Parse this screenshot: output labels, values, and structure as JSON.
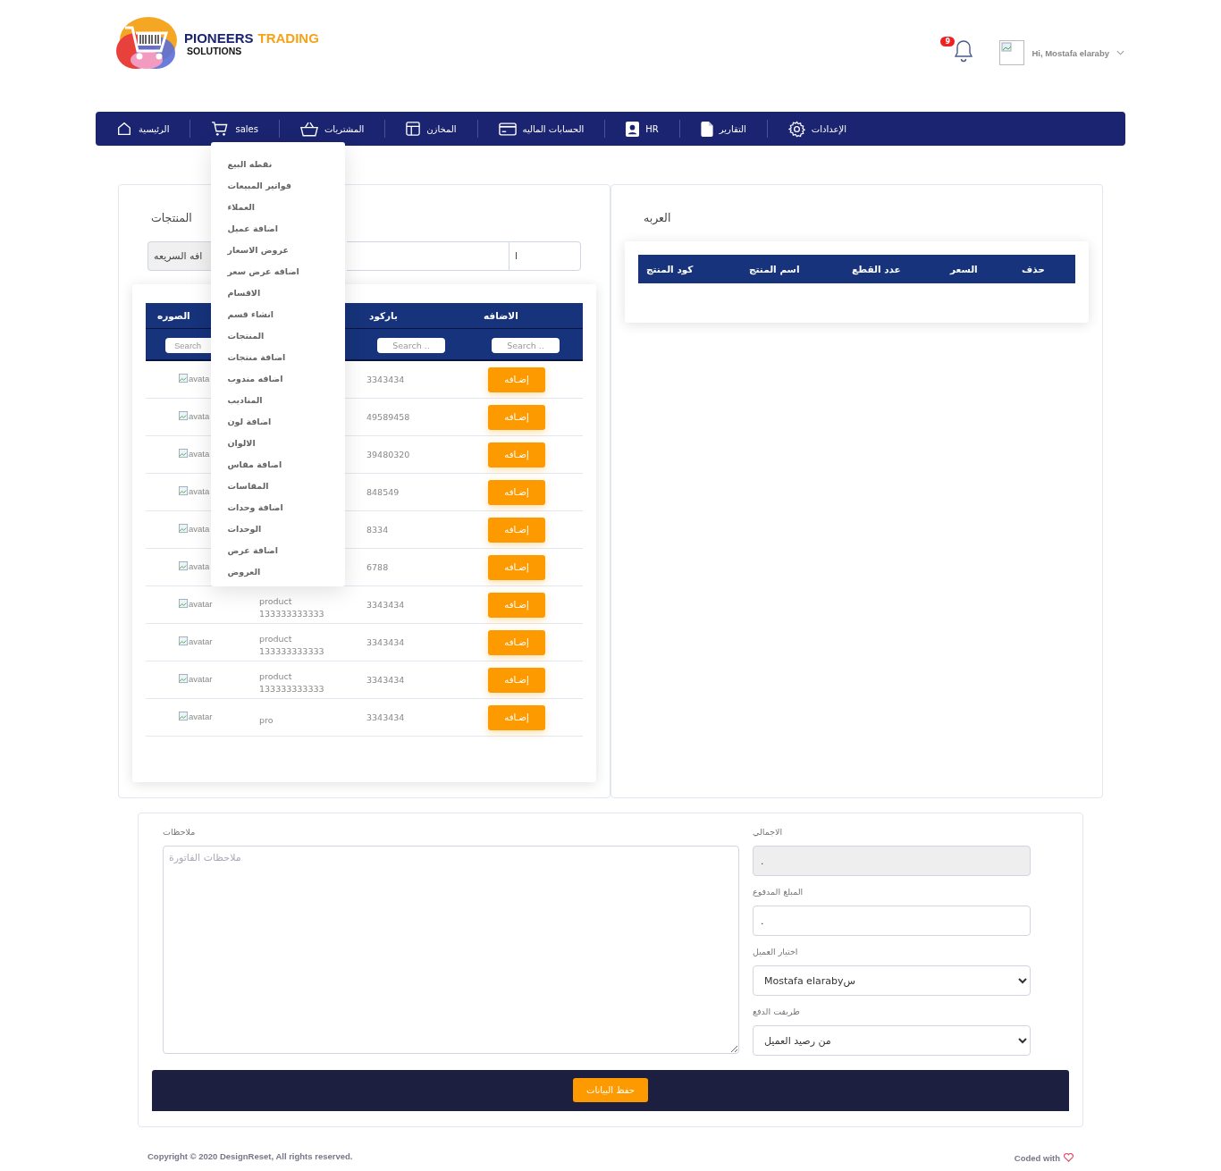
{
  "header": {
    "logo": {
      "word_1": "PIONEERS",
      "word_2": "TRADING",
      "word_3": "SOLUTIONS"
    },
    "notifications": {
      "count": "9"
    },
    "user": {
      "greeting": "Hi, Mostafa elaraby"
    }
  },
  "nav": [
    {
      "label": "الإعدادات",
      "kind": "gear"
    },
    {
      "label": "التقارير",
      "kind": "file"
    },
    {
      "label": "HR",
      "kind": "badge"
    },
    {
      "label": "الحسابات الماليه",
      "kind": "card"
    },
    {
      "label": "المخازن",
      "kind": "layout"
    },
    {
      "label": "المشتريات",
      "kind": "basket"
    },
    {
      "label": "sales",
      "kind": "cart",
      "menu": [
        "نقطه البيع",
        "فواتير المبيعات",
        "العملاء",
        "اضافة عميل",
        "عروض الاسعار",
        "اضافه عرض سعر",
        "الاقسام",
        "انشاء قسم",
        "المنتجات",
        "اضافة منتجات",
        "اضافه مندوب",
        "المناديب",
        "اضافة لون",
        "الالوان",
        "اضافة مقاس",
        "المقاسات",
        "اضافة وحدات",
        "الوحدات",
        "اضافة عرض",
        "العروض"
      ]
    },
    {
      "label": "الرئيسية",
      "kind": "home"
    }
  ],
  "products": {
    "title": "المنتجات",
    "quick_add": "افه السريعه",
    "input_addon": "ا",
    "columns": [
      {
        "label": "الاضافه",
        "placeholder": "Search .."
      },
      {
        "label": "باركود",
        "placeholder": "Search .."
      },
      {},
      {
        "label": "الصوره",
        "placeholder": "Search"
      }
    ],
    "rows": [
      {
        "image": "avata",
        "barcode": "3343434",
        "action": "إضـافه"
      },
      {
        "image": "avata",
        "barcode": "49589458",
        "action": "إضـافه"
      },
      {
        "image": "avata",
        "barcode": "39480320",
        "action": "إضـافه"
      },
      {
        "image": "avata",
        "barcode": "848549",
        "action": "إضـافه"
      },
      {
        "image": "avata",
        "barcode": "8334",
        "action": "إضـافه"
      },
      {
        "image": "avata",
        "barcode": "6788",
        "action": "إضـافه"
      },
      {
        "image": "avatar",
        "name": "product 133333333333",
        "barcode": "3343434",
        "action": "إضـافه"
      },
      {
        "image": "avatar",
        "name": "product 133333333333",
        "barcode": "3343434",
        "action": "إضـافه"
      },
      {
        "image": "avatar",
        "name": "product 133333333333",
        "barcode": "3343434",
        "action": "إضـافه"
      },
      {
        "image": "avatar",
        "name": "pro",
        "barcode": "3343434",
        "action": "إضـافه"
      }
    ]
  },
  "cart": {
    "title": "العربه",
    "columns": [
      "حذف",
      "السعر",
      "عدد القطع",
      "اسم المنتج",
      "كود المنتج"
    ]
  },
  "invoice": {
    "notes_label": "ملاحظات",
    "notes_placeholder": "ملاحظات الفاتورة",
    "fields": [
      {
        "label": "الاجمالي",
        "kind": "input",
        "value": ".",
        "disabled": true
      },
      {
        "label": "المبلغ المدفوع",
        "kind": "input",
        "value": ".",
        "disabled": false
      },
      {
        "label": "اختيار العميل",
        "kind": "select",
        "value": "Mostafa elarabyس",
        "disabled": false
      },
      {
        "label": "طريقت الدفع",
        "kind": "select",
        "value": "من رصيد العميل",
        "disabled": false
      }
    ],
    "save": "حفظ البيانات"
  },
  "footer": {
    "copyright": "Copyright © 2020 DesignReset, All rights reserved.",
    "coded": "Coded with"
  }
}
